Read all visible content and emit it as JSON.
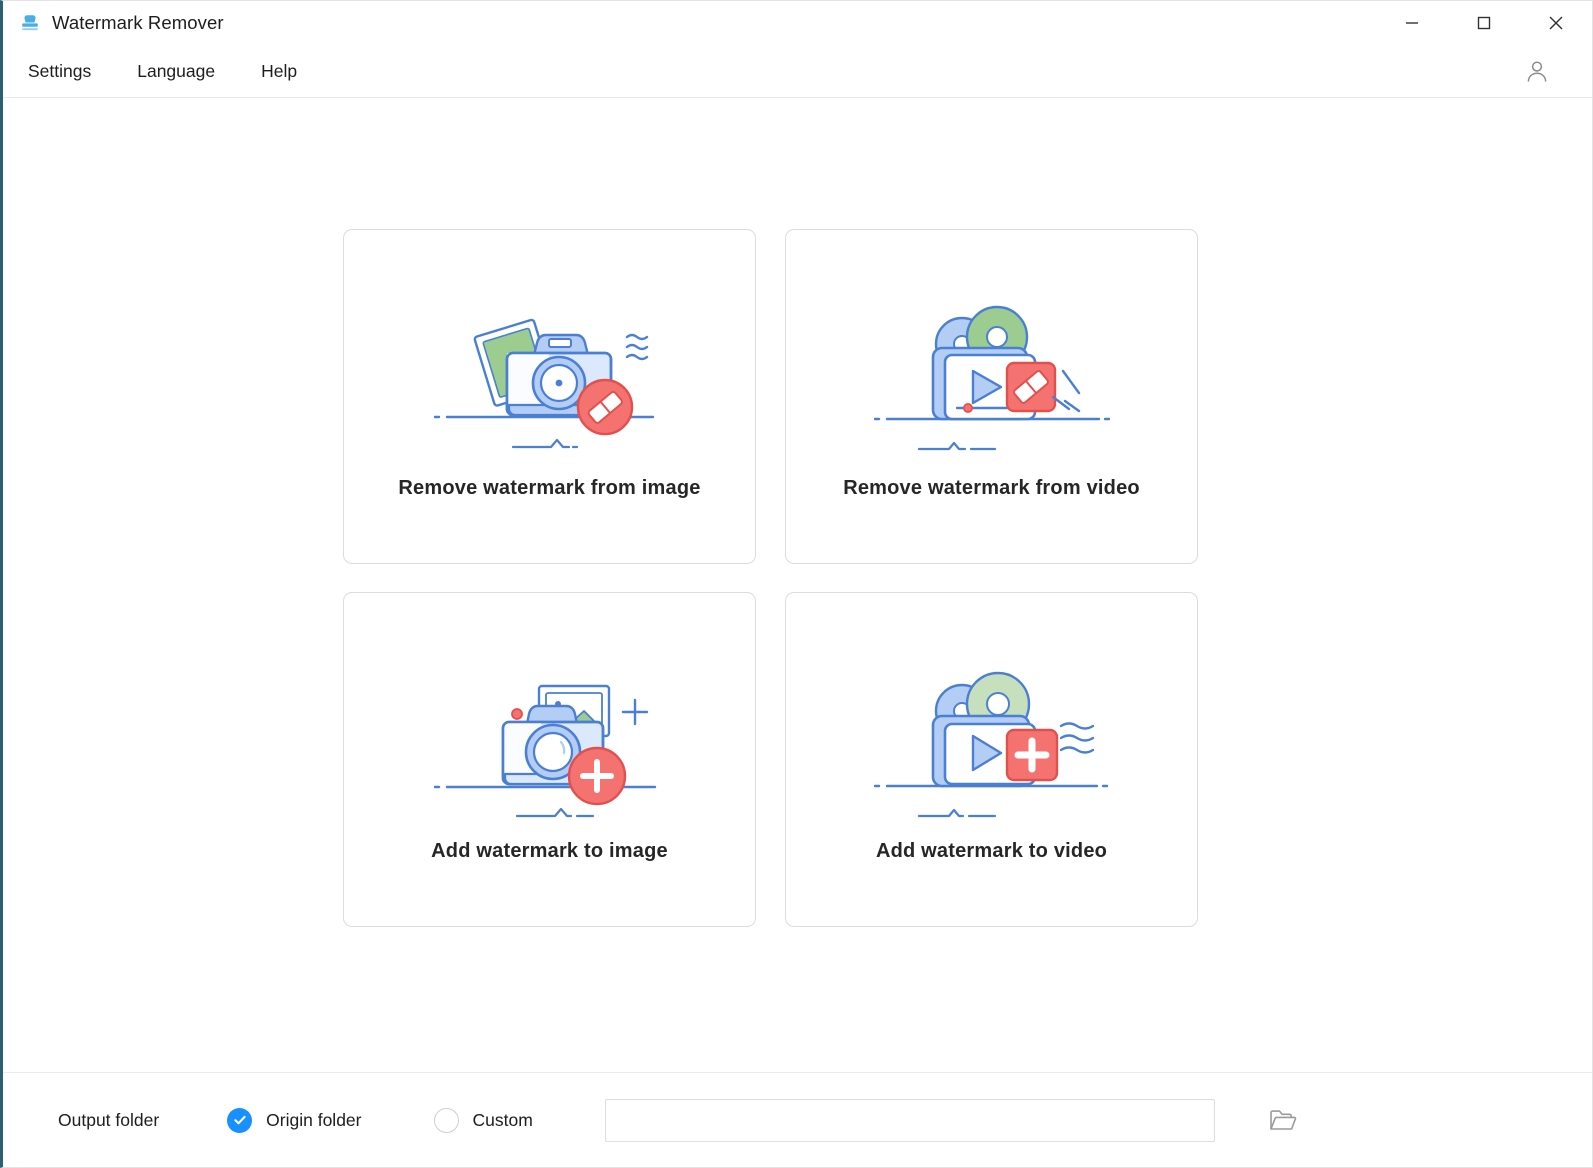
{
  "window": {
    "title": "Watermark Remover",
    "app_icon": "stamp-icon",
    "controls": {
      "minimize": "minimize-icon",
      "maximize": "maximize-icon",
      "close": "close-icon"
    }
  },
  "menubar": {
    "items": [
      {
        "label": "Settings"
      },
      {
        "label": "Language"
      },
      {
        "label": "Help"
      }
    ],
    "account_icon": "user-account-icon"
  },
  "main": {
    "cards": [
      {
        "id": "remove-watermark-from-image",
        "label": "Remove watermark from image",
        "art": "camera-photo-eraser-illustration"
      },
      {
        "id": "remove-watermark-from-video",
        "label": "Remove watermark from video",
        "art": "video-player-eraser-illustration"
      },
      {
        "id": "add-watermark-to-image",
        "label": "Add watermark to image",
        "art": "camera-photo-plus-illustration"
      },
      {
        "id": "add-watermark-to-video",
        "label": "Add watermark to video",
        "art": "video-player-plus-illustration"
      }
    ]
  },
  "footer": {
    "output_folder_label": "Output folder",
    "options": [
      {
        "label": "Origin folder",
        "selected": true
      },
      {
        "label": "Custom",
        "selected": false
      }
    ],
    "custom_path_value": "",
    "custom_path_placeholder": "",
    "browse_icon": "open-folder-icon"
  },
  "colors": {
    "accent": "#1890ff",
    "illustration_blue_line": "#4a7fd4",
    "illustration_blue_fill": "#b4cdf4",
    "illustration_blue_light": "#dce8fb",
    "illustration_green": "#9ccc8f",
    "illustration_red": "#f4726f",
    "illustration_red_line": "#e2504d",
    "card_border": "#dcdcdc",
    "title_bar_bg": "#ffffff",
    "window_edge": "#2b5f73"
  }
}
